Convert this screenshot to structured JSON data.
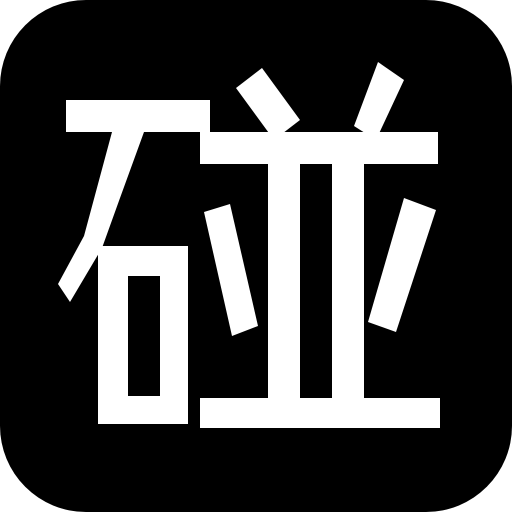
{
  "app_icon": {
    "glyph": "碰",
    "background_color": "#000000",
    "glyph_color": "#ffffff"
  }
}
